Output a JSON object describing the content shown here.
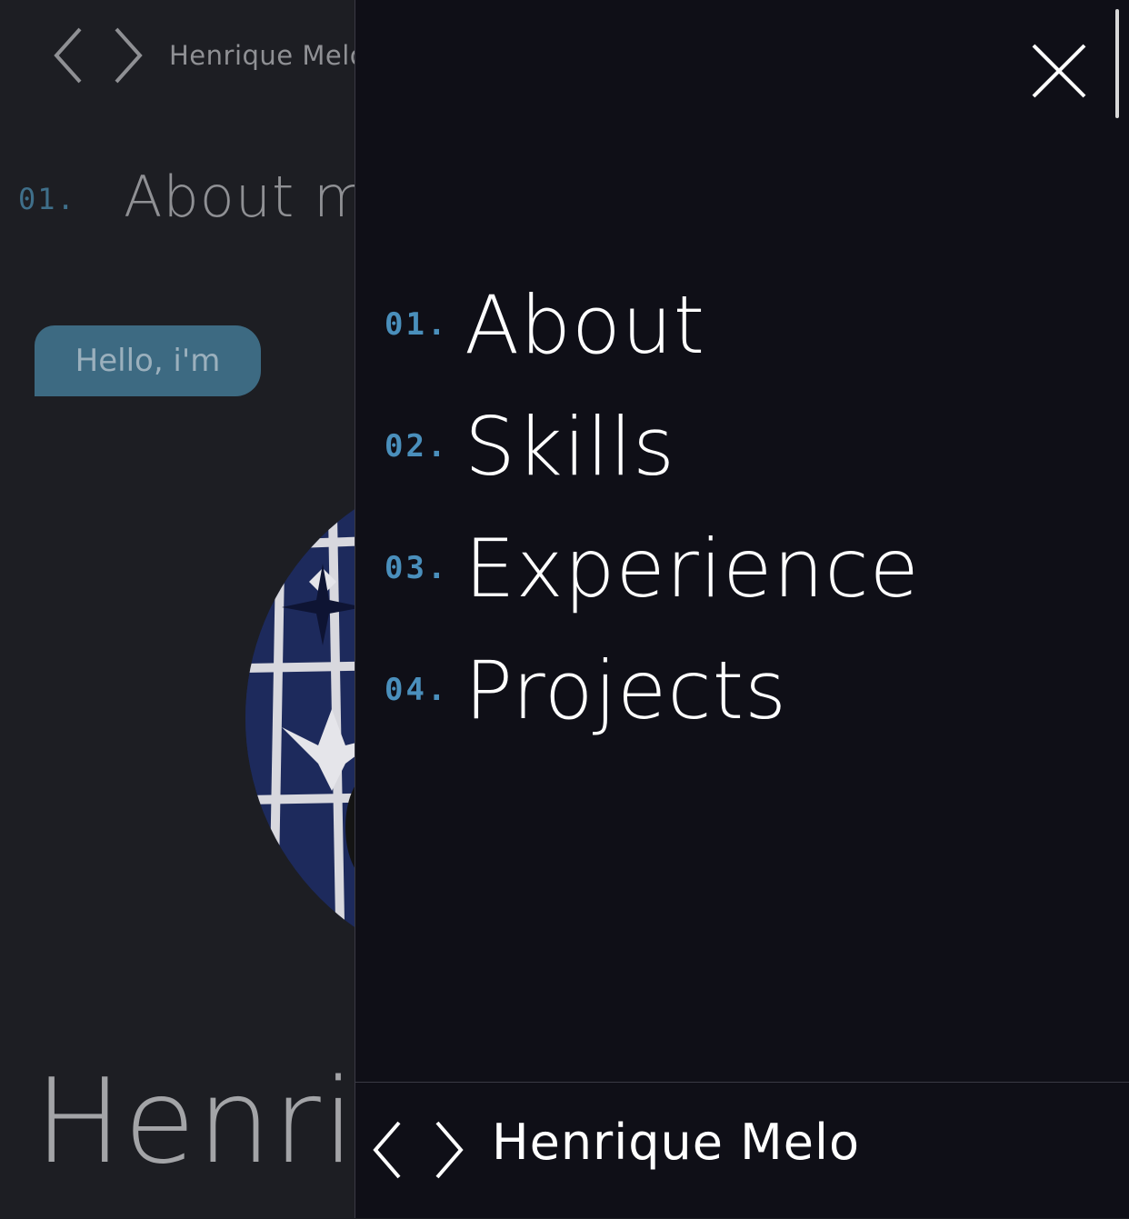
{
  "background": {
    "header": {
      "logo_name": "Henrique Melo"
    },
    "section": {
      "number": "01.",
      "title": "About me"
    },
    "greeting_badge": "Hello, i'm",
    "hero_name": "Henrique Melo"
  },
  "drawer": {
    "menu": [
      {
        "number": "01.",
        "label": "About"
      },
      {
        "number": "02.",
        "label": "Skills"
      },
      {
        "number": "03.",
        "label": "Experience"
      },
      {
        "number": "04.",
        "label": "Projects"
      }
    ],
    "footer": {
      "logo_name": "Henrique Melo"
    }
  },
  "icons": {
    "logo": "code-brackets-icon",
    "close": "close-icon"
  },
  "colors": {
    "page_bg": "#1d1e23",
    "drawer_bg": "#0f0f17",
    "accent": "#4a8fbc",
    "badge": "#3d6a82",
    "text": "#ffffff"
  }
}
